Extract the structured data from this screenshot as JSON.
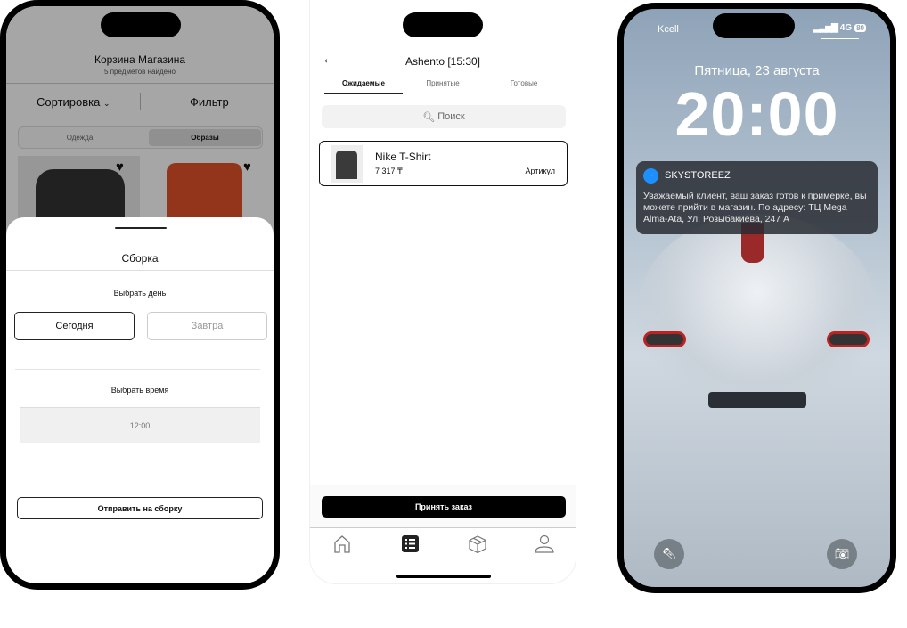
{
  "cart_screen": {
    "title": "Корзина Магазина",
    "subtitle": "5 предметов найдено",
    "sort_label": "Сортировка",
    "filter_label": "Фильтр",
    "segments": [
      "Одежда",
      "Образы"
    ],
    "selected_segment": "Образы",
    "sheet": {
      "title": "Сборка",
      "day_label": "Выбрать день",
      "day_options": [
        "Сегодня",
        "Завтра"
      ],
      "selected_day": "Сегодня",
      "time_label": "Выбрать время",
      "time_value": "12:00",
      "submit_label": "Отправить на сборку"
    }
  },
  "orders_screen": {
    "title": "Ashento [15:30]",
    "tabs": [
      "Ожидаемые",
      "Принятые",
      "Готовые"
    ],
    "active_tab": "Ожидаемые",
    "search_placeholder": "Поиск",
    "items": [
      {
        "name": "Nike T-Shirt",
        "price": "7 317 ₸",
        "sku_label": "Артикул"
      }
    ],
    "accept_label": "Принять заказ",
    "nav": [
      "home-icon",
      "list-icon",
      "box-icon",
      "profile-icon"
    ],
    "active_nav": "list-icon"
  },
  "lock_screen": {
    "carrier": "Kcell",
    "network": "4G",
    "battery": "80",
    "date": "Пятница, 23 августа",
    "time": "20:00",
    "notification": {
      "app": "SKYSTOREEZ",
      "text": "Уважаемый клиент, ваш заказ готов к примерке, вы можете прийти в магазин. По адресу: ТЦ Mega Alma-Ata, Ул. Розыбакиева, 247 А",
      "icon_color": "#1e8fff"
    }
  }
}
